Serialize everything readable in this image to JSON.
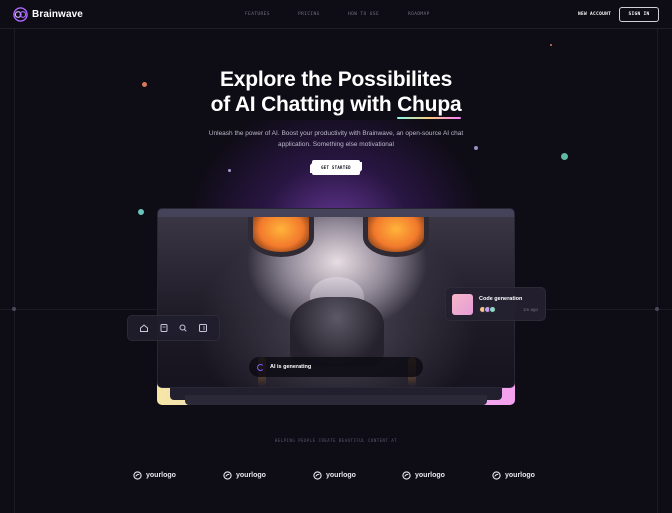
{
  "brand": {
    "name": "Brainwave"
  },
  "nav": {
    "items": [
      "FEATURES",
      "PRICING",
      "HOW TO USE",
      "ROADMAP"
    ],
    "new_account": "NEW ACCOUNT",
    "sign_in": "SIGN IN"
  },
  "hero": {
    "title_line1": "Explore the Possibilites",
    "title_line2_prefix": "of AI Chatting with ",
    "title_highlight": "Chupa",
    "subtitle": "Unleash the power of AI. Boost your productivity with Brainwave, an open-source AI chat application. Something else motivational",
    "cta": "GET STARTED"
  },
  "preview": {
    "generating_text": "AI is generating",
    "toolbar_icons": [
      "home-icon",
      "file-icon",
      "search-icon",
      "plus-square-icon"
    ],
    "code_card": {
      "title": "Code generation",
      "time": "1m ago"
    }
  },
  "partners": {
    "heading": "HELPING PEOPLE CREATE BEAUTIFUL CONTENT AT",
    "logos": [
      "yourlogo",
      "yourlogo",
      "yourlogo",
      "yourlogo",
      "yourlogo"
    ]
  },
  "colors": {
    "background": "#0e0c15",
    "accent_purple": "#ac6aff",
    "gradient_start": "#89f9e8",
    "gradient_mid": "#facb7b",
    "gradient_end": "#fa7cfb"
  }
}
